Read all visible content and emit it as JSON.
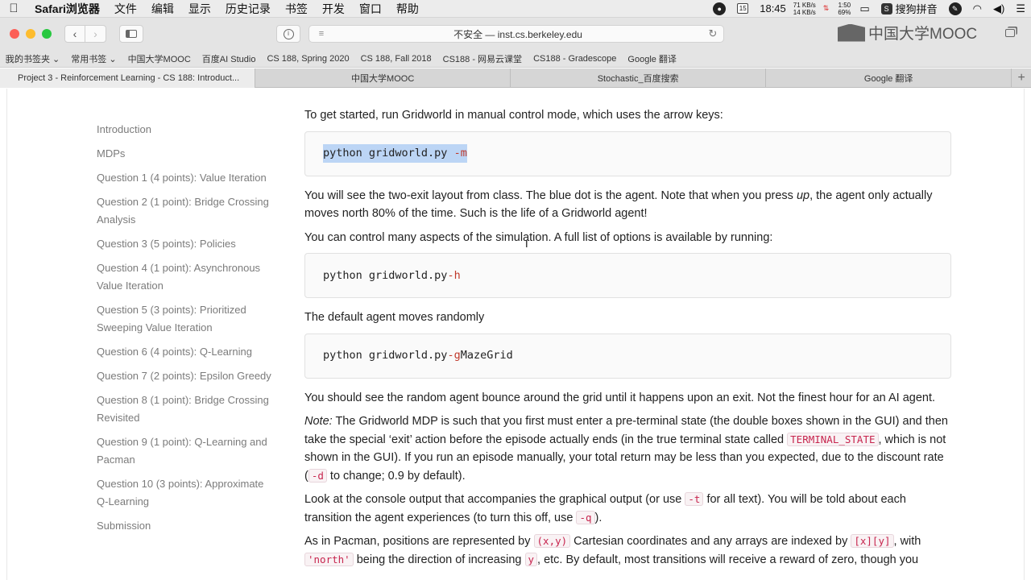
{
  "menubar": {
    "app": "Safari浏览器",
    "items": [
      "文件",
      "编辑",
      "显示",
      "历史记录",
      "书签",
      "开发",
      "窗口",
      "帮助"
    ],
    "calendar_day": "15",
    "time": "18:45",
    "net_up": "71 KB/s",
    "net_down": "14 KB/s",
    "battery_time": "1:50",
    "battery_pct": "69%",
    "input_method": "搜狗拼音"
  },
  "toolbar": {
    "address": "不安全 — inst.cs.berkeley.edu",
    "logo": "中国大学MOOC"
  },
  "bookmarks": [
    "我的书签夹 ⌄",
    "常用书签 ⌄",
    "中国大学MOOC",
    "百度AI Studio",
    "CS 188, Spring 2020",
    "CS 188, Fall 2018",
    "CS188 - 网易云课堂",
    "CS188 - Gradescope",
    "Google 翻译"
  ],
  "tabs": [
    "Project 3 - Reinforcement Learning - CS 188: Introduct...",
    "中国大学MOOC",
    "Stochastic_百度搜索",
    "Google 翻译"
  ],
  "sidenav": [
    "Introduction",
    "MDPs",
    "Question 1 (4 points): Value Iteration",
    "Question 2 (1 point): Bridge Crossing Analysis",
    "Question 3 (5 points): Policies",
    "Question 4 (1 point): Asynchronous Value Iteration",
    "Question 5 (3 points): Prioritized Sweeping Value Iteration",
    "Question 6 (4 points): Q-Learning",
    "Question 7 (2 points): Epsilon Greedy",
    "Question 8 (1 point): Bridge Crossing Revisited",
    "Question 9 (1 point): Q-Learning and Pacman",
    "Question 10 (3 points): Approximate Q-Learning",
    "Submission"
  ],
  "content": {
    "p_intro": "To get started, run Gridworld in manual control mode, which uses the arrow keys:",
    "code1_cmd": "python gridworld.py ",
    "code1_flag": "-m",
    "p_twoexit_a": "You will see the two-exit layout from class. The blue dot is the agent. Note that when you press ",
    "p_twoexit_em": "up",
    "p_twoexit_b": ", the agent only actually moves north 80% of the time. Such is the life of a Gridworld agent!",
    "p_control": "You can control many aspects of the simulation. A full list of options is available by running:",
    "code2_cmd": "python gridworld.py ",
    "code2_flag": "-h",
    "p_default": "The default agent moves randomly",
    "code3_cmd": "python gridworld.py ",
    "code3_flag": "-g",
    "code3_arg": " MazeGrid",
    "p_random": "You should see the random agent bounce around the grid until it happens upon an exit. Not the finest hour for an AI agent.",
    "p_note_label": "Note:",
    "p_note_a": " The Gridworld MDP is such that you first must enter a pre-terminal state (the double boxes shown in the GUI) and then take the special ‘exit’ action before the episode actually ends (in the true terminal state called ",
    "p_note_code": "TERMINAL_STATE",
    "p_note_b": ", which is not shown in the GUI). If you run an episode manually, your total return may be less than you expected, due to the discount rate (",
    "p_note_code2": "-d",
    "p_note_c": " to change; 0.9 by default).",
    "p_console_a": "Look at the console output that accompanies the graphical output (or use ",
    "p_console_code": "-t",
    "p_console_b": " for all text). You will be told about each transition the agent experiences (to turn this off, use ",
    "p_console_code2": "-q",
    "p_console_c": ").",
    "p_pos_a": "As in Pacman, positions are represented by ",
    "p_pos_code1": "(x,y)",
    "p_pos_b": " Cartesian coordinates and any arrays are indexed by ",
    "p_pos_code2": "[x][y]",
    "p_pos_c": ", with ",
    "p_pos_code3": "'north'",
    "p_pos_d": " being the direction of increasing ",
    "p_pos_code4": "y",
    "p_pos_e": ", etc. By default, most transitions will receive a reward of zero, though you"
  }
}
